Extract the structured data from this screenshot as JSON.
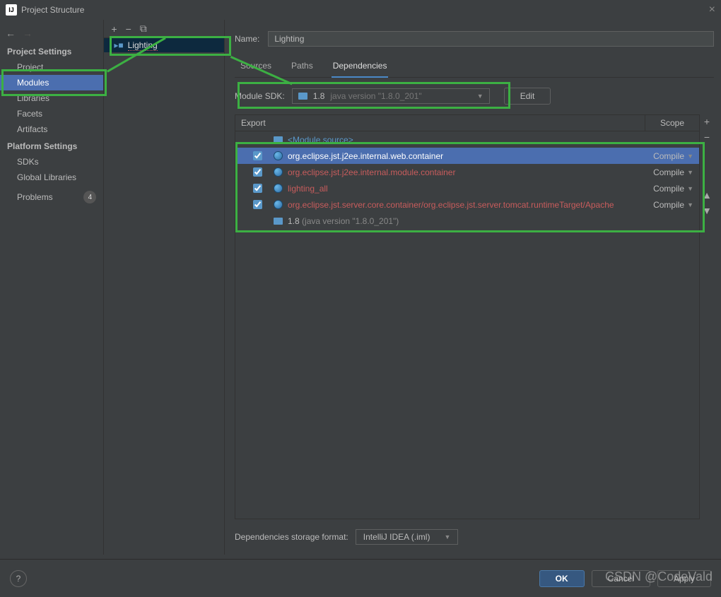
{
  "window": {
    "title": "Project Structure"
  },
  "sidebar": {
    "headings": {
      "project": "Project Settings",
      "platform": "Platform Settings"
    },
    "items": {
      "project": "Project",
      "modules": "Modules",
      "libraries": "Libraries",
      "facets": "Facets",
      "artifacts": "Artifacts",
      "sdks": "SDKs",
      "global_libs": "Global Libraries",
      "problems": "Problems"
    },
    "problems_count": "4"
  },
  "module_tree": {
    "item": "Lighting"
  },
  "content": {
    "name_label": "Name:",
    "name_value": "Lighting",
    "tabs": {
      "sources": "Sources",
      "paths": "Paths",
      "dependencies": "Dependencies"
    },
    "sdk_label": "Module SDK:",
    "sdk_version": "1.8",
    "sdk_detail": "java version \"1.8.0_201\"",
    "edit_btn": "Edit",
    "table": {
      "col_export": "Export",
      "col_scope": "Scope",
      "rows": [
        {
          "checked": false,
          "name": "<Module source>",
          "scope": "",
          "type": "module-source"
        },
        {
          "checked": true,
          "name": "org.eclipse.jst.j2ee.internal.web.container",
          "scope": "Compile",
          "type": "lib",
          "selected": true
        },
        {
          "checked": true,
          "name": "org.eclipse.jst.j2ee.internal.module.container",
          "scope": "Compile",
          "type": "lib"
        },
        {
          "checked": true,
          "name": "lighting_all",
          "scope": "Compile",
          "type": "lib"
        },
        {
          "checked": true,
          "name": "org.eclipse.jst.server.core.container/org.eclipse.jst.server.tomcat.runtimeTarget/Apache",
          "scope": "Compile",
          "type": "lib"
        },
        {
          "checked": false,
          "name": "1.8",
          "detail": "(java version \"1.8.0_201\")",
          "scope": "",
          "type": "sdk"
        }
      ]
    },
    "storage_label": "Dependencies storage format:",
    "storage_value": "IntelliJ IDEA (.iml)"
  },
  "buttons": {
    "ok": "OK",
    "cancel": "Cancel",
    "apply": "Apply"
  },
  "watermark": "CSDN @CodeVald"
}
